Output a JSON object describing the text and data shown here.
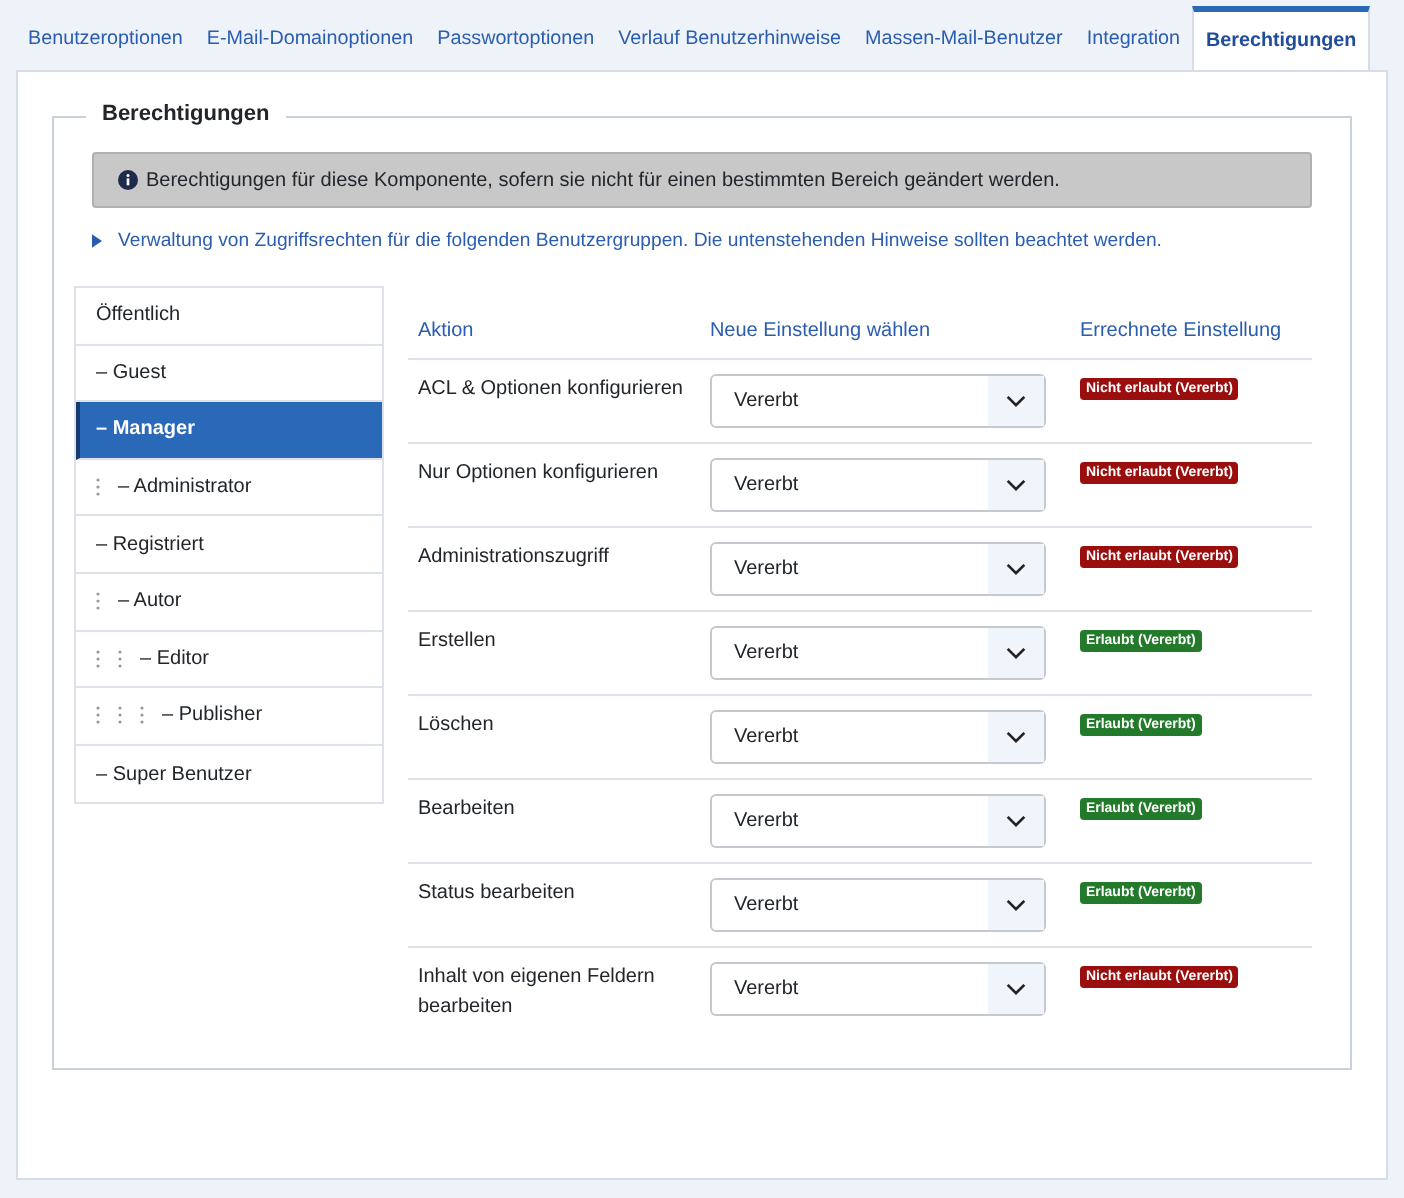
{
  "tabs": [
    {
      "label": "Benutzeroptionen",
      "selected": false
    },
    {
      "label": "E-Mail-Domainoptionen",
      "selected": false
    },
    {
      "label": "Passwortoptionen",
      "selected": false
    },
    {
      "label": "Verlauf Benutzerhinweise",
      "selected": false
    },
    {
      "label": "Massen-Mail-Benutzer",
      "selected": false
    },
    {
      "label": "Integration",
      "selected": false
    },
    {
      "label": "Berechtigungen",
      "selected": true
    }
  ],
  "fieldset": {
    "legend": "Berechtigungen",
    "alert": "Berechtigungen für diese Komponente, sofern sie nicht für einen bestimmten Bereich geändert werden.",
    "toggle_link": "Verwaltung von Zugriffsrechten für die folgenden Benutzergruppen. Die untenstehenden Hinweise sollten beachtet werden.",
    "groups": [
      {
        "label": "Öffentlich",
        "selected": false,
        "children": [
          {
            "label": "– Guest",
            "selected": false
          },
          {
            "label": "– Manager",
            "selected": true,
            "children": [
              {
                "label": "– Administrator",
                "selected": false
              }
            ]
          },
          {
            "label": "– Registriert",
            "selected": false,
            "children": [
              {
                "label": "– Autor",
                "selected": false,
                "children": [
                  {
                    "label": "– Editor",
                    "selected": false,
                    "children": [
                      {
                        "label": "– Publisher",
                        "selected": false
                      }
                    ]
                  }
                ]
              }
            ]
          },
          {
            "label": "– Super Benutzer",
            "selected": false
          }
        ]
      }
    ],
    "table": {
      "columns": [
        "Aktion",
        "Neue Einstellung wählen",
        "Errechnete Einstellung"
      ],
      "rows": [
        {
          "action": "ACL & Optionen konfigurieren",
          "setting": "Vererbt",
          "result": {
            "kind": "denied",
            "label": "Nicht erlaubt (Vererbt)"
          }
        },
        {
          "action": "Nur Optionen konfigurieren",
          "setting": "Vererbt",
          "result": {
            "kind": "denied",
            "label": "Nicht erlaubt (Vererbt)"
          }
        },
        {
          "action": "Administrationszugriff",
          "setting": "Vererbt",
          "result": {
            "kind": "denied",
            "label": "Nicht erlaubt (Vererbt)"
          }
        },
        {
          "action": "Erstellen",
          "setting": "Vererbt",
          "result": {
            "kind": "allowed",
            "label": "Erlaubt (Vererbt)"
          }
        },
        {
          "action": "Löschen",
          "setting": "Vererbt",
          "result": {
            "kind": "allowed",
            "label": "Erlaubt (Vererbt)"
          }
        },
        {
          "action": "Bearbeiten",
          "setting": "Vererbt",
          "result": {
            "kind": "allowed",
            "label": "Erlaubt (Vererbt)"
          }
        },
        {
          "action": "Status bearbeiten",
          "setting": "Vererbt",
          "result": {
            "kind": "allowed",
            "label": "Erlaubt (Vererbt)"
          }
        },
        {
          "action": "Inhalt von eigenen Feldern bearbeiten",
          "setting": "Vererbt",
          "result": {
            "kind": "denied",
            "label": "Nicht erlaubt (Vererbt)"
          }
        }
      ]
    }
  }
}
